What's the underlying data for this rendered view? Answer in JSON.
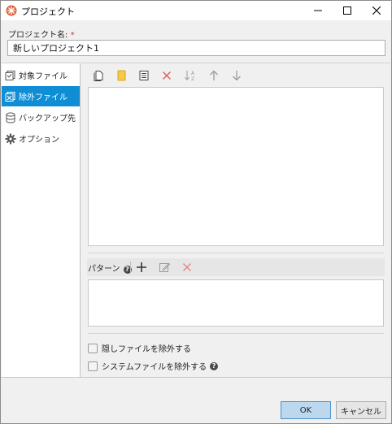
{
  "window": {
    "title": "プロジェクト"
  },
  "form": {
    "project_name_label": "プロジェクト名:",
    "required_mark": "*",
    "project_name_value": "新しいプロジェクト1"
  },
  "sidebar": {
    "items": [
      {
        "label": "対象ファイル",
        "icon": "target-files-icon"
      },
      {
        "label": "除外ファイル",
        "icon": "excluded-files-icon",
        "selected": true
      },
      {
        "label": "バックアップ先",
        "icon": "database-icon"
      },
      {
        "label": "オプション",
        "icon": "gear-icon"
      }
    ]
  },
  "pattern": {
    "label": "パターン"
  },
  "options": {
    "exclude_hidden": "隠しファイルを除外する",
    "exclude_system": "システムファイルを除外する"
  },
  "buttons": {
    "ok": "OK",
    "cancel": "キャンセル"
  },
  "colors": {
    "accent": "#0f8ed6",
    "delete": "#e06060",
    "folder": "#f7c948"
  }
}
